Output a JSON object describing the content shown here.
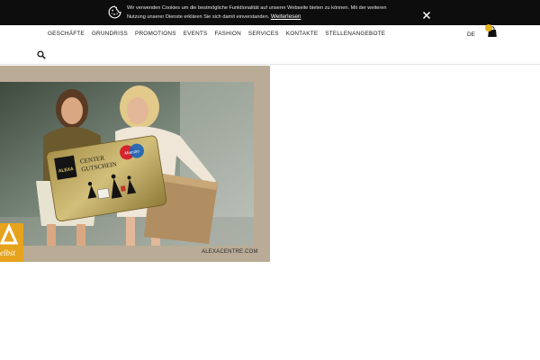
{
  "cookie": {
    "text": "Wir verwenden Cookies um die bestmögliche Funktionalität auf unserer Webseite bieten zu können. Mit der weiteren Nutzung unserer Dienste erklären Sie sich damit einverstanden.",
    "link": "Weiterlesen",
    "icons": {
      "cookie": "cookie-icon",
      "close": "close-icon"
    }
  },
  "nav": {
    "items": [
      "GESCHÄFTE",
      "GRUNDRISS",
      "PROMOTIONS",
      "EVENTS",
      "FASHION",
      "SERVICES",
      "KONTAKTE",
      "STELLENANGEBOTE"
    ],
    "language": "DE",
    "cart_count": "",
    "icons": {
      "cart": "shopping-bag-icon",
      "search": "search-icon"
    }
  },
  "banner": {
    "card_line1": "CENTER",
    "card_line2": "GUTSCHEIN",
    "card_brand": "ALEXA",
    "card_payment": "Maestro",
    "footer": "ALEXACENTRE.COM",
    "badge_text": "elbst"
  },
  "colors": {
    "cookie_bg": "#0d0d0d",
    "banner_bg": "#b9ab96",
    "badge": "#e6a31c",
    "card": "#b5a25c"
  }
}
